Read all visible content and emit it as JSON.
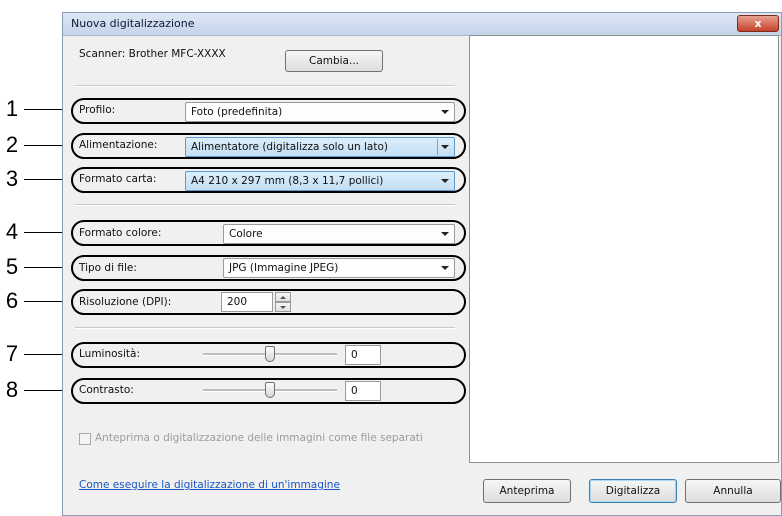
{
  "window": {
    "title": "Nuova digitalizzazione",
    "close_label": "x"
  },
  "scanner": {
    "label": "Scanner: Brother MFC-XXXX",
    "change_button": "Cambia..."
  },
  "callouts": [
    "1",
    "2",
    "3",
    "4",
    "5",
    "6",
    "7",
    "8"
  ],
  "profile": {
    "label": "Profilo:",
    "value": "Foto (predefinita)"
  },
  "source": {
    "label": "Alimentazione:",
    "value": "Alimentatore (digitalizza solo un lato)"
  },
  "paper_size": {
    "label": "Formato carta:",
    "value": "A4 210 x 297 mm (8,3 x 11,7 pollici)"
  },
  "color_format": {
    "label": "Formato colore:",
    "value": "Colore"
  },
  "file_type": {
    "label": "Tipo di file:",
    "value": "JPG (Immagine JPEG)"
  },
  "resolution": {
    "label": "Risoluzione (DPI):",
    "value": "200"
  },
  "brightness": {
    "label": "Luminosità:",
    "value": "0",
    "level": 0.5
  },
  "contrast": {
    "label": "Contrasto:",
    "value": "0",
    "level": 0.5
  },
  "separate_files": {
    "label": "Anteprima o digitalizzazione delle immagini come file separati",
    "checked": false
  },
  "help_link": "Come eseguire la digitalizzazione di un'immagine",
  "buttons": {
    "preview": "Anteprima",
    "scan": "Digitalizza",
    "cancel": "Annulla"
  },
  "icons": {
    "close": "close-icon",
    "dropdown": "chevron-down-icon",
    "spin": "spinner-arrows-icon"
  }
}
